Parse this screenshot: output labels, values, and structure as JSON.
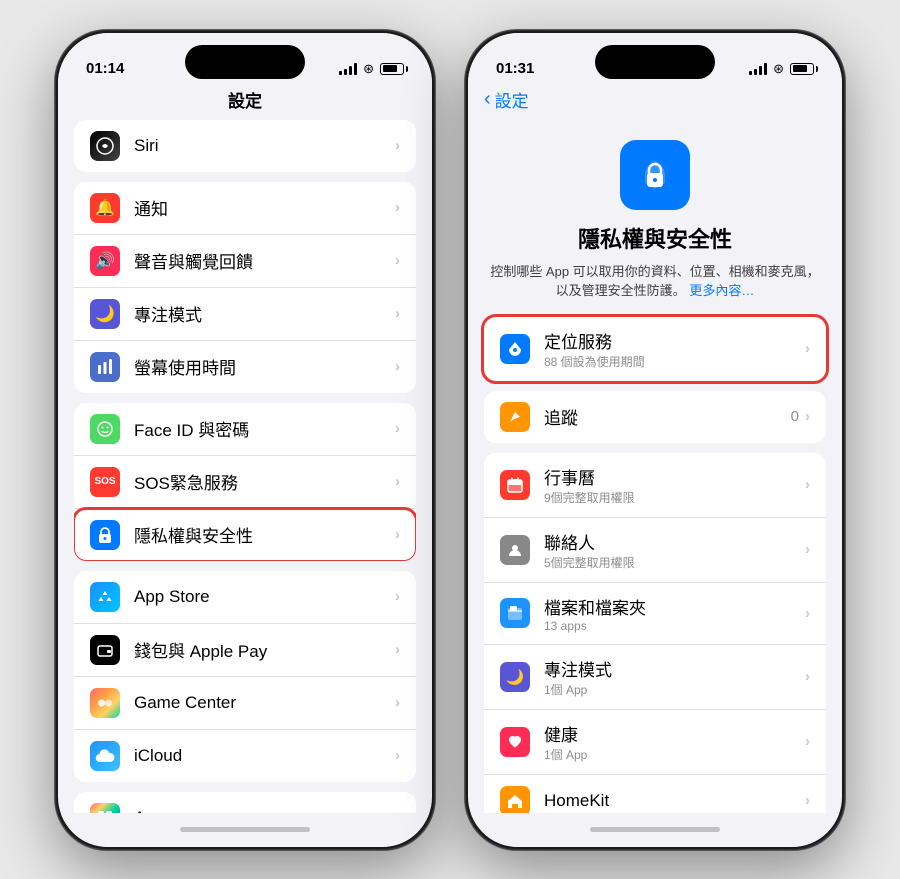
{
  "phone1": {
    "time": "01:14",
    "title": "設定",
    "items_top": [
      {
        "id": "siri",
        "label": "Siri",
        "icon_class": "icon-siri",
        "icon": "🎙",
        "highlighted": false
      }
    ],
    "groups": [
      {
        "items": [
          {
            "id": "notification",
            "label": "通知",
            "icon_class": "icon-notification",
            "icon": "🔔",
            "highlighted": false
          },
          {
            "id": "sound",
            "label": "聲音與觸覺回饋",
            "icon_class": "icon-sound",
            "icon": "🔊",
            "highlighted": false
          },
          {
            "id": "focus",
            "label": "專注模式",
            "icon_class": "icon-focus",
            "icon": "🌙",
            "highlighted": false
          },
          {
            "id": "screentime",
            "label": "螢幕使用時間",
            "icon_class": "icon-screen-time",
            "icon": "⏱",
            "highlighted": false
          }
        ]
      },
      {
        "items": [
          {
            "id": "faceid",
            "label": "Face ID 與密碼",
            "icon_class": "icon-faceid",
            "icon": "😊",
            "highlighted": false
          },
          {
            "id": "sos",
            "label": "SOS緊急服務",
            "icon_class": "icon-sos",
            "icon": "🆘",
            "highlighted": false
          },
          {
            "id": "privacy",
            "label": "隱私權與安全性",
            "icon_class": "icon-privacy",
            "icon": "✋",
            "highlighted": true
          }
        ]
      },
      {
        "items": [
          {
            "id": "appstore",
            "label": "App Store",
            "icon_class": "icon-appstore",
            "icon": "A",
            "highlighted": false
          },
          {
            "id": "wallet",
            "label": "錢包與 Apple Pay",
            "icon_class": "icon-wallet",
            "icon": "💳",
            "highlighted": false
          },
          {
            "id": "gamecenter",
            "label": "Game Center",
            "icon_class": "icon-gamecenter",
            "icon": "🎮",
            "highlighted": false
          },
          {
            "id": "icloud",
            "label": "iCloud",
            "icon_class": "icon-icloud",
            "icon": "☁",
            "highlighted": false
          }
        ]
      },
      {
        "items": [
          {
            "id": "app",
            "label": "App",
            "icon_class": "icon-app",
            "icon": "⊞",
            "highlighted": false
          }
        ]
      }
    ]
  },
  "phone2": {
    "time": "01:31",
    "back_label": "設定",
    "header_icon": "✋",
    "header_title": "隱私權與安全性",
    "header_desc": "控制哪些 App 可以取用你的資料、位置、相機和麥克風，以及管理安全性防護。",
    "header_more": "更多內容…",
    "groups": [
      {
        "highlighted": true,
        "items": [
          {
            "id": "location",
            "label": "定位服務",
            "sub": "88 個設為使用期間",
            "icon_class": "icon-location",
            "icon": "➤",
            "value": "",
            "highlighted": true
          }
        ]
      },
      {
        "highlighted": false,
        "items": [
          {
            "id": "tracking",
            "label": "追蹤",
            "sub": "",
            "icon_class": "icon-tracking",
            "icon": "↗",
            "value": "0",
            "highlighted": false
          }
        ]
      },
      {
        "highlighted": false,
        "items": [
          {
            "id": "calendar",
            "label": "行事曆",
            "sub": "9個完整取用權限",
            "icon_class": "icon-calendar",
            "icon": "📅",
            "value": "",
            "highlighted": false
          },
          {
            "id": "contacts",
            "label": "聯絡人",
            "sub": "5個完整取用權限",
            "icon_class": "icon-contacts",
            "icon": "👤",
            "value": "",
            "highlighted": false
          },
          {
            "id": "files",
            "label": "檔案和檔案夾",
            "sub": "13 apps",
            "icon_class": "icon-files",
            "icon": "📁",
            "value": "",
            "highlighted": false
          },
          {
            "id": "focus-r",
            "label": "專注模式",
            "sub": "1個 App",
            "icon_class": "icon-focus-r",
            "icon": "🌙",
            "value": "",
            "highlighted": false
          },
          {
            "id": "health",
            "label": "健康",
            "sub": "1個 App",
            "icon_class": "icon-health",
            "icon": "❤",
            "value": "",
            "highlighted": false
          },
          {
            "id": "homekit",
            "label": "HomeKit",
            "sub": "",
            "icon_class": "icon-homekit",
            "icon": "🏠",
            "value": "",
            "highlighted": false
          }
        ]
      }
    ]
  },
  "icons": {
    "chevron": "›",
    "back": "‹"
  }
}
